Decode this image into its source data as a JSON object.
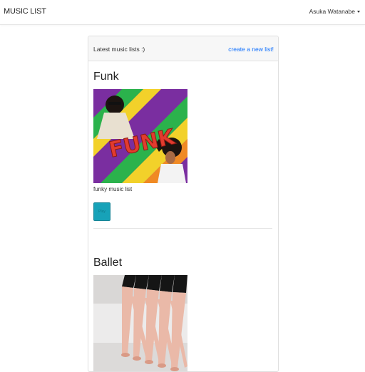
{
  "nav": {
    "brand": "MUSIC LIST",
    "user_name": "Asuka Watanabe"
  },
  "card": {
    "header_text": "Latest music lists :)",
    "new_list_link": "create a new list!"
  },
  "lists": [
    {
      "title": "Funk",
      "description": "funky music list",
      "button_label": "Play",
      "image_text": "FUNK",
      "colors": {
        "accent": "#17a2b8"
      }
    },
    {
      "title": "Ballet"
    }
  ]
}
